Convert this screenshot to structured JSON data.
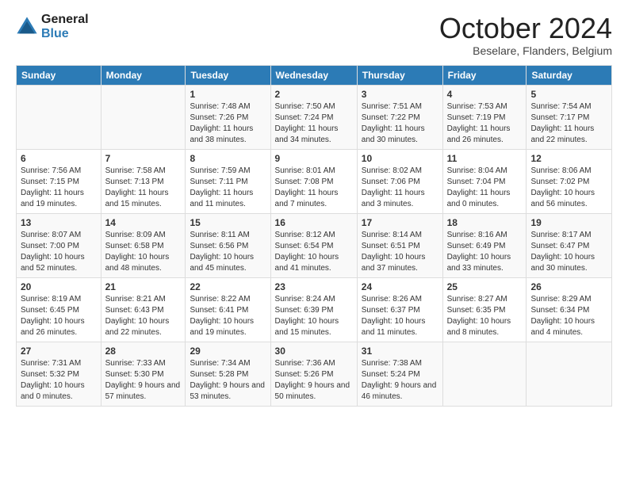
{
  "logo": {
    "line1": "General",
    "line2": "Blue"
  },
  "header": {
    "month": "October 2024",
    "location": "Beselare, Flanders, Belgium"
  },
  "weekdays": [
    "Sunday",
    "Monday",
    "Tuesday",
    "Wednesday",
    "Thursday",
    "Friday",
    "Saturday"
  ],
  "weeks": [
    [
      {
        "day": "",
        "detail": ""
      },
      {
        "day": "",
        "detail": ""
      },
      {
        "day": "1",
        "detail": "Sunrise: 7:48 AM\nSunset: 7:26 PM\nDaylight: 11 hours and 38 minutes."
      },
      {
        "day": "2",
        "detail": "Sunrise: 7:50 AM\nSunset: 7:24 PM\nDaylight: 11 hours and 34 minutes."
      },
      {
        "day": "3",
        "detail": "Sunrise: 7:51 AM\nSunset: 7:22 PM\nDaylight: 11 hours and 30 minutes."
      },
      {
        "day": "4",
        "detail": "Sunrise: 7:53 AM\nSunset: 7:19 PM\nDaylight: 11 hours and 26 minutes."
      },
      {
        "day": "5",
        "detail": "Sunrise: 7:54 AM\nSunset: 7:17 PM\nDaylight: 11 hours and 22 minutes."
      }
    ],
    [
      {
        "day": "6",
        "detail": "Sunrise: 7:56 AM\nSunset: 7:15 PM\nDaylight: 11 hours and 19 minutes."
      },
      {
        "day": "7",
        "detail": "Sunrise: 7:58 AM\nSunset: 7:13 PM\nDaylight: 11 hours and 15 minutes."
      },
      {
        "day": "8",
        "detail": "Sunrise: 7:59 AM\nSunset: 7:11 PM\nDaylight: 11 hours and 11 minutes."
      },
      {
        "day": "9",
        "detail": "Sunrise: 8:01 AM\nSunset: 7:08 PM\nDaylight: 11 hours and 7 minutes."
      },
      {
        "day": "10",
        "detail": "Sunrise: 8:02 AM\nSunset: 7:06 PM\nDaylight: 11 hours and 3 minutes."
      },
      {
        "day": "11",
        "detail": "Sunrise: 8:04 AM\nSunset: 7:04 PM\nDaylight: 11 hours and 0 minutes."
      },
      {
        "day": "12",
        "detail": "Sunrise: 8:06 AM\nSunset: 7:02 PM\nDaylight: 10 hours and 56 minutes."
      }
    ],
    [
      {
        "day": "13",
        "detail": "Sunrise: 8:07 AM\nSunset: 7:00 PM\nDaylight: 10 hours and 52 minutes."
      },
      {
        "day": "14",
        "detail": "Sunrise: 8:09 AM\nSunset: 6:58 PM\nDaylight: 10 hours and 48 minutes."
      },
      {
        "day": "15",
        "detail": "Sunrise: 8:11 AM\nSunset: 6:56 PM\nDaylight: 10 hours and 45 minutes."
      },
      {
        "day": "16",
        "detail": "Sunrise: 8:12 AM\nSunset: 6:54 PM\nDaylight: 10 hours and 41 minutes."
      },
      {
        "day": "17",
        "detail": "Sunrise: 8:14 AM\nSunset: 6:51 PM\nDaylight: 10 hours and 37 minutes."
      },
      {
        "day": "18",
        "detail": "Sunrise: 8:16 AM\nSunset: 6:49 PM\nDaylight: 10 hours and 33 minutes."
      },
      {
        "day": "19",
        "detail": "Sunrise: 8:17 AM\nSunset: 6:47 PM\nDaylight: 10 hours and 30 minutes."
      }
    ],
    [
      {
        "day": "20",
        "detail": "Sunrise: 8:19 AM\nSunset: 6:45 PM\nDaylight: 10 hours and 26 minutes."
      },
      {
        "day": "21",
        "detail": "Sunrise: 8:21 AM\nSunset: 6:43 PM\nDaylight: 10 hours and 22 minutes."
      },
      {
        "day": "22",
        "detail": "Sunrise: 8:22 AM\nSunset: 6:41 PM\nDaylight: 10 hours and 19 minutes."
      },
      {
        "day": "23",
        "detail": "Sunrise: 8:24 AM\nSunset: 6:39 PM\nDaylight: 10 hours and 15 minutes."
      },
      {
        "day": "24",
        "detail": "Sunrise: 8:26 AM\nSunset: 6:37 PM\nDaylight: 10 hours and 11 minutes."
      },
      {
        "day": "25",
        "detail": "Sunrise: 8:27 AM\nSunset: 6:35 PM\nDaylight: 10 hours and 8 minutes."
      },
      {
        "day": "26",
        "detail": "Sunrise: 8:29 AM\nSunset: 6:34 PM\nDaylight: 10 hours and 4 minutes."
      }
    ],
    [
      {
        "day": "27",
        "detail": "Sunrise: 7:31 AM\nSunset: 5:32 PM\nDaylight: 10 hours and 0 minutes."
      },
      {
        "day": "28",
        "detail": "Sunrise: 7:33 AM\nSunset: 5:30 PM\nDaylight: 9 hours and 57 minutes."
      },
      {
        "day": "29",
        "detail": "Sunrise: 7:34 AM\nSunset: 5:28 PM\nDaylight: 9 hours and 53 minutes."
      },
      {
        "day": "30",
        "detail": "Sunrise: 7:36 AM\nSunset: 5:26 PM\nDaylight: 9 hours and 50 minutes."
      },
      {
        "day": "31",
        "detail": "Sunrise: 7:38 AM\nSunset: 5:24 PM\nDaylight: 9 hours and 46 minutes."
      },
      {
        "day": "",
        "detail": ""
      },
      {
        "day": "",
        "detail": ""
      }
    ]
  ]
}
